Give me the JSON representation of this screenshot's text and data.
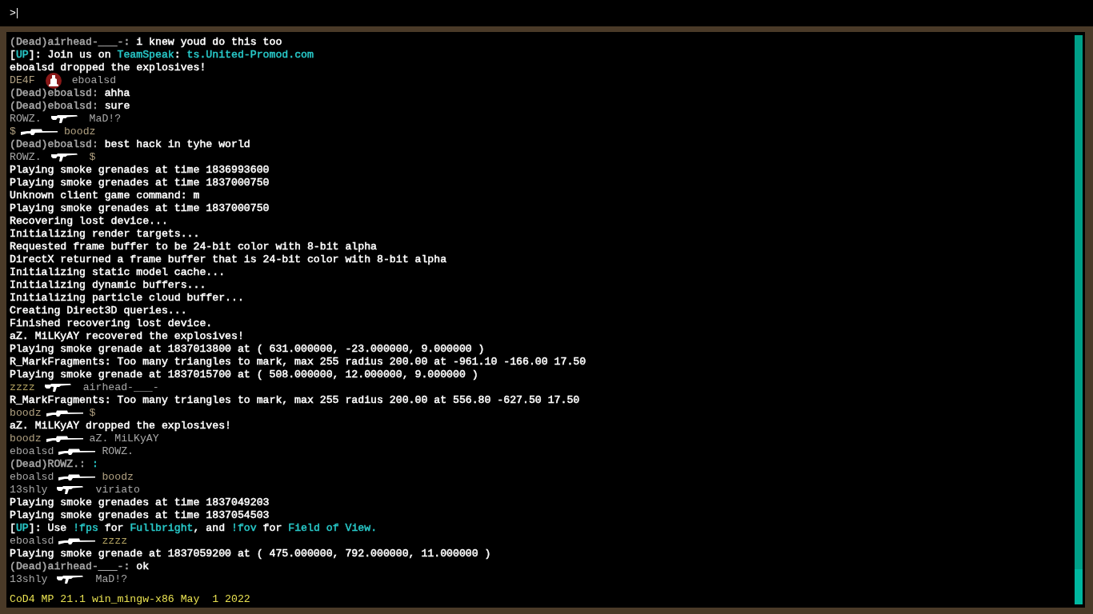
{
  "input": {
    "prompt": ">"
  },
  "log": [
    {
      "kind": "text",
      "segments": [
        {
          "text": "(Dead)airhead-___-:",
          "color": "#a8a8a8"
        },
        {
          "text": " i knew youd do this too",
          "color": "#ffffff"
        }
      ]
    },
    {
      "kind": "text",
      "segments": [
        {
          "text": "[",
          "color": "#ffffff"
        },
        {
          "text": "UP",
          "color": "#28c8c8"
        },
        {
          "text": "]: Join us on ",
          "color": "#ffffff"
        },
        {
          "text": "TeamSpeak",
          "color": "#28c8c8"
        },
        {
          "text": ": ",
          "color": "#ffffff"
        },
        {
          "text": "ts.United-Promod.com",
          "color": "#28c8c8"
        }
      ]
    },
    {
      "kind": "text",
      "segments": [
        {
          "text": "eboalsd dropped the explosives!",
          "color": "#ffffff"
        }
      ]
    },
    {
      "kind": "kill",
      "attacker": {
        "text": "DE4F",
        "color": "#b0a080"
      },
      "icon": {
        "kind": "emblem"
      },
      "victim": {
        "text": "eboalsd",
        "color": "#a8a8a8"
      }
    },
    {
      "kind": "text",
      "segments": [
        {
          "text": "(Dead)eboalsd:",
          "color": "#a8a8a8"
        },
        {
          "text": " ahha",
          "color": "#ffffff"
        }
      ]
    },
    {
      "kind": "text",
      "segments": [
        {
          "text": "(Dead)eboalsd:",
          "color": "#a8a8a8"
        },
        {
          "text": " sure",
          "color": "#ffffff"
        }
      ]
    },
    {
      "kind": "kill",
      "attacker": {
        "text": "ROWZ.",
        "color": "#a8a8a8"
      },
      "icon": {
        "kind": "rifle"
      },
      "victim": {
        "text": "MaD!?",
        "color": "#a8a8a8"
      }
    },
    {
      "kind": "kill",
      "attacker": {
        "text": "$",
        "color": "#b0a080"
      },
      "icon": {
        "kind": "sniper"
      },
      "victim": {
        "text": "boodz",
        "color": "#b0a080"
      }
    },
    {
      "kind": "text",
      "segments": [
        {
          "text": "(Dead)eboalsd:",
          "color": "#a8a8a8"
        },
        {
          "text": " best hack in tyhe world",
          "color": "#ffffff"
        }
      ]
    },
    {
      "kind": "kill",
      "attacker": {
        "text": "ROWZ.",
        "color": "#a8a8a8"
      },
      "icon": {
        "kind": "rifle"
      },
      "victim": {
        "text": "$",
        "color": "#b0a080"
      }
    },
    {
      "kind": "text",
      "segments": [
        {
          "text": "Playing smoke grenades at time 1836993600",
          "color": "#ffffff"
        }
      ]
    },
    {
      "kind": "text",
      "segments": [
        {
          "text": "Playing smoke grenades at time 1837000750",
          "color": "#ffffff"
        }
      ]
    },
    {
      "kind": "text",
      "segments": [
        {
          "text": "Unknown client game command: m",
          "color": "#ffffff"
        }
      ]
    },
    {
      "kind": "text",
      "segments": [
        {
          "text": "Playing smoke grenades at time 1837000750",
          "color": "#ffffff"
        }
      ]
    },
    {
      "kind": "text",
      "segments": [
        {
          "text": "Recovering lost device...",
          "color": "#ffffff"
        }
      ]
    },
    {
      "kind": "text",
      "segments": [
        {
          "text": "Initializing render targets...",
          "color": "#ffffff"
        }
      ]
    },
    {
      "kind": "text",
      "segments": [
        {
          "text": "Requested frame buffer to be 24-bit color with 8-bit alpha",
          "color": "#ffffff"
        }
      ]
    },
    {
      "kind": "text",
      "segments": [
        {
          "text": "DirectX returned a frame buffer that is 24-bit color with 8-bit alpha",
          "color": "#ffffff"
        }
      ]
    },
    {
      "kind": "text",
      "segments": [
        {
          "text": "Initializing static model cache...",
          "color": "#ffffff"
        }
      ]
    },
    {
      "kind": "text",
      "segments": [
        {
          "text": "Initializing dynamic buffers...",
          "color": "#ffffff"
        }
      ]
    },
    {
      "kind": "text",
      "segments": [
        {
          "text": "Initializing particle cloud buffer...",
          "color": "#ffffff"
        }
      ]
    },
    {
      "kind": "text",
      "segments": [
        {
          "text": "Creating Direct3D queries...",
          "color": "#ffffff"
        }
      ]
    },
    {
      "kind": "text",
      "segments": [
        {
          "text": "Finished recovering lost device.",
          "color": "#ffffff"
        }
      ]
    },
    {
      "kind": "text",
      "segments": [
        {
          "text": "aZ. MiLKyAY recovered the explosives!",
          "color": "#ffffff"
        }
      ]
    },
    {
      "kind": "text",
      "segments": [
        {
          "text": "Playing smoke grenade at 1837013800 at ( 631.000000, -23.000000, 9.000000 )",
          "color": "#ffffff"
        }
      ]
    },
    {
      "kind": "text",
      "segments": [
        {
          "text": "R_MarkFragments: Too many triangles to mark, max 255 radius 200.00 at -961.10 -166.00 17.50",
          "color": "#ffffff"
        }
      ]
    },
    {
      "kind": "text",
      "segments": [
        {
          "text": "Playing smoke grenade at 1837015700 at ( 508.000000, 12.000000, 9.000000 )",
          "color": "#ffffff"
        }
      ]
    },
    {
      "kind": "kill",
      "attacker": {
        "text": "zzzz",
        "color": "#b0a060"
      },
      "icon": {
        "kind": "rifle"
      },
      "victim": {
        "text": "airhead-___-",
        "color": "#a8a8a8"
      }
    },
    {
      "kind": "text",
      "segments": [
        {
          "text": "R_MarkFragments: Too many triangles to mark, max 255 radius 200.00 at 556.80 -627.50 17.50",
          "color": "#ffffff"
        }
      ]
    },
    {
      "kind": "kill",
      "attacker": {
        "text": "boodz",
        "color": "#b0a080"
      },
      "icon": {
        "kind": "sniper"
      },
      "victim": {
        "text": "$",
        "color": "#b0a080"
      }
    },
    {
      "kind": "text",
      "segments": [
        {
          "text": "aZ. MiLKyAY dropped the explosives!",
          "color": "#ffffff"
        }
      ]
    },
    {
      "kind": "kill",
      "attacker": {
        "text": "boodz",
        "color": "#b0a080"
      },
      "icon": {
        "kind": "sniper"
      },
      "victim": {
        "text": "aZ. MiLKyAY",
        "color": "#a8a8a8"
      }
    },
    {
      "kind": "kill",
      "attacker": {
        "text": "eboalsd",
        "color": "#a8a8a8"
      },
      "icon": {
        "kind": "sniper"
      },
      "victim": {
        "text": "ROWZ.",
        "color": "#a8a8a8"
      }
    },
    {
      "kind": "text",
      "segments": [
        {
          "text": "(Dead)ROWZ.: ",
          "color": "#a8a8a8"
        },
        {
          "text": ":",
          "color": "#28c8c8"
        }
      ]
    },
    {
      "kind": "kill",
      "attacker": {
        "text": "eboalsd",
        "color": "#a8a8a8"
      },
      "icon": {
        "kind": "sniper"
      },
      "victim": {
        "text": "boodz",
        "color": "#b0a080"
      }
    },
    {
      "kind": "kill",
      "attacker": {
        "text": "13shly",
        "color": "#a8a8a8"
      },
      "icon": {
        "kind": "rifle"
      },
      "victim": {
        "text": "viriato",
        "color": "#a8a8a8"
      }
    },
    {
      "kind": "text",
      "segments": [
        {
          "text": "Playing smoke grenades at time 1837049203",
          "color": "#ffffff"
        }
      ]
    },
    {
      "kind": "text",
      "segments": [
        {
          "text": "Playing smoke grenades at time 1837054503",
          "color": "#ffffff"
        }
      ]
    },
    {
      "kind": "text",
      "segments": [
        {
          "text": "[",
          "color": "#ffffff"
        },
        {
          "text": "UP",
          "color": "#28c8c8"
        },
        {
          "text": "]: Use ",
          "color": "#ffffff"
        },
        {
          "text": "!fps",
          "color": "#28c8c8"
        },
        {
          "text": " for ",
          "color": "#ffffff"
        },
        {
          "text": "Fullbright",
          "color": "#28c8c8"
        },
        {
          "text": ", and ",
          "color": "#ffffff"
        },
        {
          "text": "!fov",
          "color": "#28c8c8"
        },
        {
          "text": " for ",
          "color": "#ffffff"
        },
        {
          "text": "Field of View.",
          "color": "#28c8c8"
        }
      ]
    },
    {
      "kind": "kill",
      "attacker": {
        "text": "eboalsd",
        "color": "#a8a8a8"
      },
      "icon": {
        "kind": "sniper"
      },
      "victim": {
        "text": "zzzz",
        "color": "#b0a060"
      }
    },
    {
      "kind": "text",
      "segments": [
        {
          "text": "Playing smoke grenade at 1837059200 at ( 475.000000, 792.000000, 11.000000 )",
          "color": "#ffffff"
        }
      ]
    },
    {
      "kind": "text",
      "segments": [
        {
          "text": "(Dead)airhead-___-:",
          "color": "#a8a8a8"
        },
        {
          "text": " ok",
          "color": "#ffffff"
        }
      ]
    },
    {
      "kind": "kill",
      "attacker": {
        "text": "13shly",
        "color": "#a8a8a8"
      },
      "icon": {
        "kind": "rifle"
      },
      "victim": {
        "text": "MaD!?",
        "color": "#a8a8a8"
      }
    }
  ],
  "version": "CoD4 MP 21.1 win_mingw-x86 May  1 2022"
}
